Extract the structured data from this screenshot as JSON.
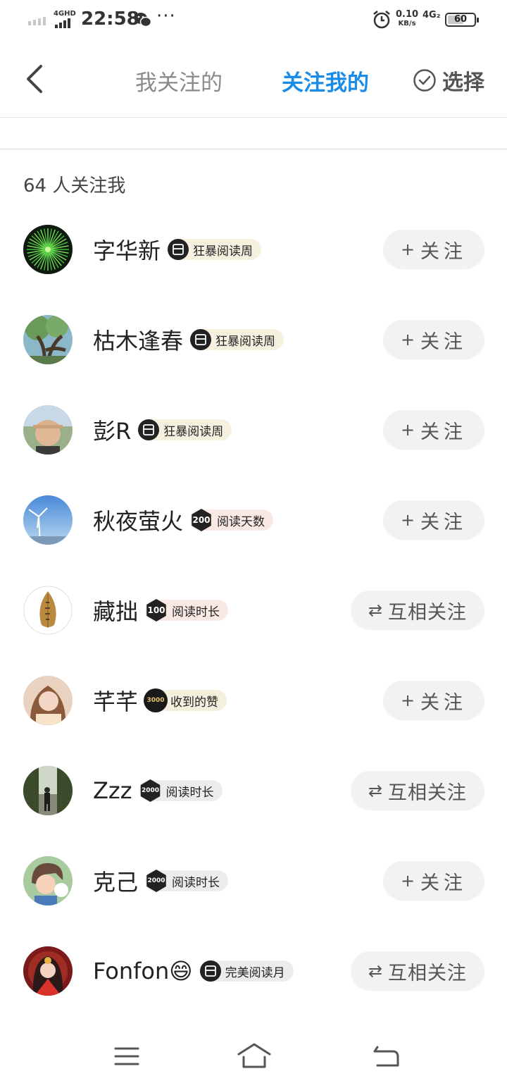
{
  "status_bar": {
    "network_label": "4GHD",
    "time": "22:58",
    "more": "···",
    "speed_value": "0.10",
    "speed_unit": "KB/s",
    "network2_label": "4G₂",
    "battery_level": "60"
  },
  "header": {
    "tab_following": "我关注的",
    "tab_followers": "关注我的",
    "select_label": "选择"
  },
  "summary": {
    "count_text": "64 人关注我"
  },
  "buttons": {
    "follow_icon": "+",
    "follow_label": "关注",
    "mutual_icon": "⇄",
    "mutual_label": "互相关注"
  },
  "followers": [
    {
      "name": "字华新",
      "badge_number": "",
      "badge_text": "狂暴阅读周",
      "badge_style": "yellow",
      "status": "follow",
      "avatar": "fireworks"
    },
    {
      "name": "枯木逢春",
      "badge_number": "",
      "badge_text": "狂暴阅读周",
      "badge_style": "yellow",
      "status": "follow",
      "avatar": "tree"
    },
    {
      "name": "彭R",
      "badge_number": "",
      "badge_text": "狂暴阅读周",
      "badge_style": "yellow",
      "status": "follow",
      "avatar": "person-cap"
    },
    {
      "name": "秋夜萤火",
      "badge_number": "200",
      "badge_text": "阅读天数",
      "badge_style": "pink",
      "status": "follow",
      "avatar": "windmill"
    },
    {
      "name": "藏拙",
      "badge_number": "100",
      "badge_text": "阅读时长",
      "badge_style": "pink",
      "status": "mutual",
      "avatar": "leaf"
    },
    {
      "name": "芊芊",
      "badge_number": "3000",
      "badge_text": "收到的赞",
      "badge_style": "gold",
      "status": "follow",
      "avatar": "girl"
    },
    {
      "name": "Zzz",
      "badge_number": "2000",
      "badge_text": "阅读时长",
      "badge_style": "gray",
      "status": "mutual",
      "avatar": "forest-walker"
    },
    {
      "name": "克己",
      "badge_number": "2000",
      "badge_text": "阅读时长",
      "badge_style": "gray",
      "status": "follow",
      "avatar": "anime-boy"
    },
    {
      "name": "Fonfon😄",
      "badge_number": "",
      "badge_text": "完美阅读月",
      "badge_style": "gray",
      "status": "mutual",
      "avatar": "anime-girl-red"
    }
  ],
  "colors": {
    "accent": "#1a8ce8",
    "tab_inactive": "#8a8a8a",
    "button_bg": "#f2f2f2"
  },
  "icons": [
    "back-icon",
    "check-circle-icon",
    "menu-icon",
    "home-icon",
    "return-icon",
    "wechat-icon",
    "alarm-icon"
  ]
}
